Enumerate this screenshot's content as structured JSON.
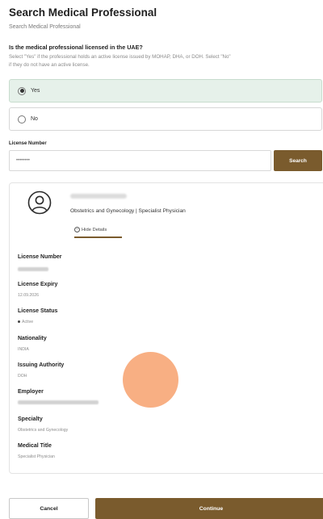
{
  "header": {
    "title": "Search Medical Professional",
    "breadcrumb": "Search Medical Professional"
  },
  "licensed_question": {
    "question": "Is the medical professional licensed in the UAE?",
    "help_line1": "Select \"Yes\" if the professional holds an active license issued by MOHAP, DHA, or DOH. Select \"No\"",
    "help_line2": "if they do not have an active license.",
    "options": [
      {
        "label": "Yes",
        "selected": true
      },
      {
        "label": "No",
        "selected": false
      }
    ]
  },
  "license_search": {
    "label": "License Number",
    "value": "",
    "placeholder": "••••••••",
    "button_label": "Search"
  },
  "professional": {
    "specialty_line": "Obstetrics and Gynecology | Specialist Physician",
    "hide_details_label": "Hide Details",
    "fields": [
      {
        "label": "License Number",
        "value": ""
      },
      {
        "label": "License Expiry",
        "value": "12.09.2026"
      },
      {
        "label": "License Status",
        "value": "Active"
      },
      {
        "label": "Nationality",
        "value": "INDIA"
      },
      {
        "label": "Issuing Authority",
        "value": "DOH"
      },
      {
        "label": "Employer",
        "value": ""
      },
      {
        "label": "Specialty",
        "value": "Obstetrics and Gynecology"
      },
      {
        "label": "Medical Title",
        "value": "Specialist Physician"
      }
    ]
  },
  "actions": {
    "cancel_label": "Cancel",
    "continue_label": "Continue"
  },
  "colors": {
    "accent": "#7a5b2d",
    "selected_bg": "#e6f1ea",
    "touch_indicator": "#f79e68"
  },
  "icons": {
    "avatar": "user-circle-icon",
    "hide_details": "minus-circle-icon"
  }
}
